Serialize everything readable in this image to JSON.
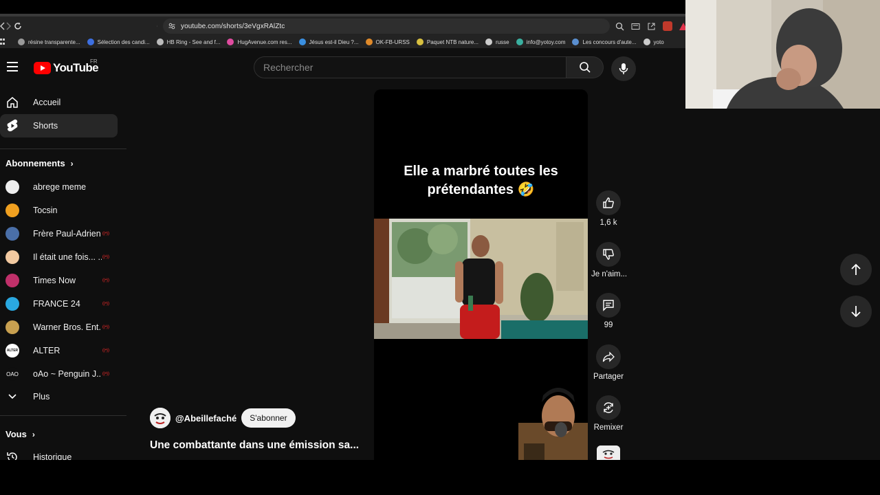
{
  "browser": {
    "url": "youtube.com/shorts/3eVgxRAlZtc",
    "bookmarks": [
      {
        "label": "résine transparente...",
        "color": "#9a9a9a"
      },
      {
        "label": "Sélection des candi...",
        "color": "#3d6fe0"
      },
      {
        "label": "HB Ring - See and f...",
        "color": "#bbbbbb"
      },
      {
        "label": "HugAvenue.com res...",
        "color": "#e04ca0"
      },
      {
        "label": "Jésus est-il Dieu ?...",
        "color": "#3a8fe0"
      },
      {
        "label": "OK-FB-URSS",
        "color": "#e08a2a"
      },
      {
        "label": "Paquet NTB nature...",
        "color": "#d8c040"
      },
      {
        "label": "russe",
        "color": "#cccccc"
      },
      {
        "label": "info@yotoy.com",
        "color": "#3ab0a0"
      },
      {
        "label": "Les concours d'aute...",
        "color": "#5a8fd0"
      },
      {
        "label": "yoto",
        "color": "#cccccc"
      }
    ]
  },
  "header": {
    "logo_text": "YouTube",
    "country": "FR",
    "search_placeholder": "Rechercher"
  },
  "sidebar": {
    "main": [
      {
        "label": "Accueil",
        "icon": "home-icon",
        "active": false
      },
      {
        "label": "Shorts",
        "icon": "shorts-icon",
        "active": true
      }
    ],
    "subscriptions_title": "Abonnements",
    "subscriptions": [
      {
        "label": "abrege meme",
        "color": "#eeeeee",
        "live": false
      },
      {
        "label": "Tocsin",
        "color": "#f0a020",
        "live": false
      },
      {
        "label": "Frère Paul-Adrien",
        "color": "#4a6fa8",
        "live": true
      },
      {
        "label": "Il était une fois... ...",
        "color": "#f2c9a0",
        "live": true
      },
      {
        "label": "Times Now",
        "color": "#c0306a",
        "live": true
      },
      {
        "label": "FRANCE 24",
        "color": "#2aa8e0",
        "live": true
      },
      {
        "label": "Warner Bros. Ent...",
        "color": "#c8a050",
        "live": true
      },
      {
        "label": "ALTER",
        "color": "#ffffff",
        "live": true
      },
      {
        "label": "oAo ~ Penguin J...",
        "color": "#0f0f0f",
        "live": true
      }
    ],
    "more_label": "Plus",
    "you_title": "Vous",
    "history_label": "Historique",
    "alter_text": "ALTER",
    "oao_text": "OAO"
  },
  "video": {
    "caption_line1": "Elle a marbré toutes les",
    "caption_line2": "prétendantes 🤣",
    "channel": "@Abeillefaché",
    "subscribe_label": "S'abonner",
    "title": "Une combattante dans une émission sa..."
  },
  "actions": {
    "like_count": "1,6 k",
    "dislike_label": "Je n'aim...",
    "comment_count": "99",
    "share_label": "Partager",
    "remix_label": "Remixer"
  },
  "colors": {
    "background": "#0f0f0f",
    "brand_red": "#ff0000",
    "button_bg": "#272727",
    "live_red": "#ff2a2a"
  }
}
